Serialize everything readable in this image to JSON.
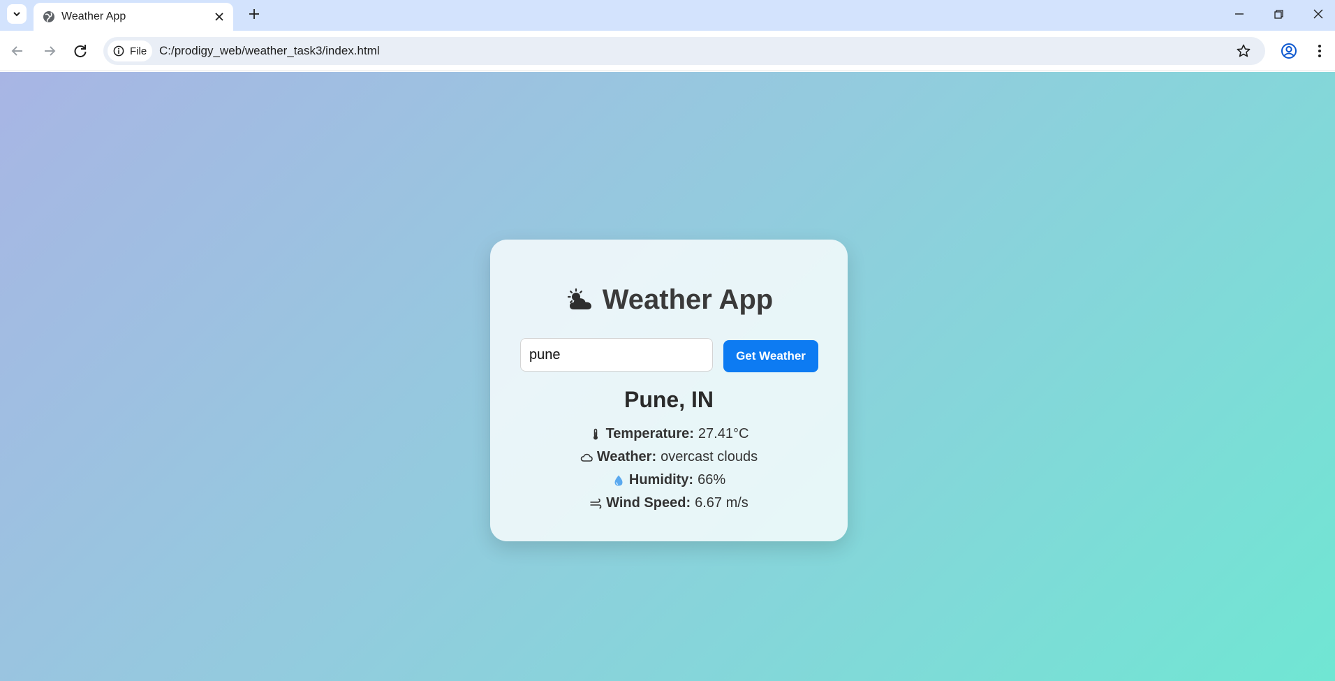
{
  "browser": {
    "tab_title": "Weather App",
    "url_chip_label": "File",
    "url": "C:/prodigy_web/weather_task3/index.html"
  },
  "app": {
    "title": "Weather App",
    "search": {
      "value": "pune",
      "button_label": "Get Weather"
    },
    "result": {
      "city": "Pune, IN",
      "rows": [
        {
          "icon": "thermometer-icon",
          "label": "Temperature:",
          "value": "27.41°C"
        },
        {
          "icon": "cloud-icon",
          "label": "Weather:",
          "value": "overcast clouds"
        },
        {
          "icon": "droplet-icon",
          "label": "Humidity:",
          "value": "66%"
        },
        {
          "icon": "wind-icon",
          "label": "Wind Speed:",
          "value": "6.67 m/s"
        }
      ]
    }
  },
  "colors": {
    "accent": "#0d7bf2",
    "gradient_start": "#a8b5e4",
    "gradient_end": "#70e6d3"
  }
}
